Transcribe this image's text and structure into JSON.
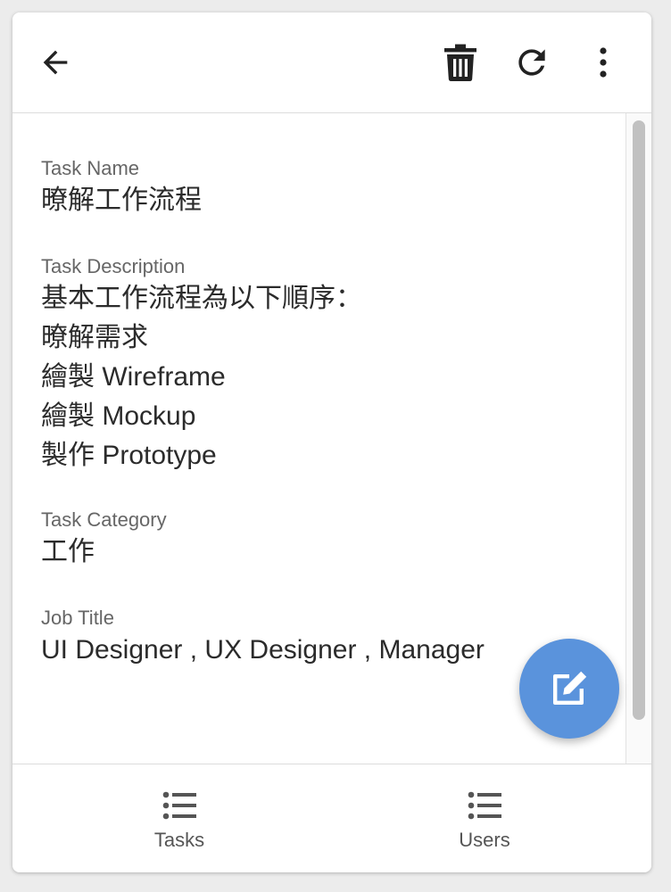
{
  "toolbar": {
    "back_icon": "arrow-left-icon",
    "delete_icon": "trash-icon",
    "refresh_icon": "refresh-icon",
    "more_icon": "more-vertical-icon"
  },
  "task": {
    "name_label": "Task Name",
    "name_value": "暸解工作流程",
    "description_label": "Task Description",
    "description_value": "基本工作流程為以下順序：\n暸解需求\n繪製 Wireframe\n繪製 Mockup\n製作 Prototype",
    "category_label": "Task Category",
    "category_value": "工作",
    "job_label": "Job Title",
    "job_value": "UI Designer , UX Designer , Manager"
  },
  "fab": {
    "icon": "edit-icon",
    "color": "#5a93dc"
  },
  "bottom_nav": {
    "items": [
      {
        "label": "Tasks",
        "icon": "list-icon"
      },
      {
        "label": "Users",
        "icon": "list-icon"
      }
    ]
  }
}
